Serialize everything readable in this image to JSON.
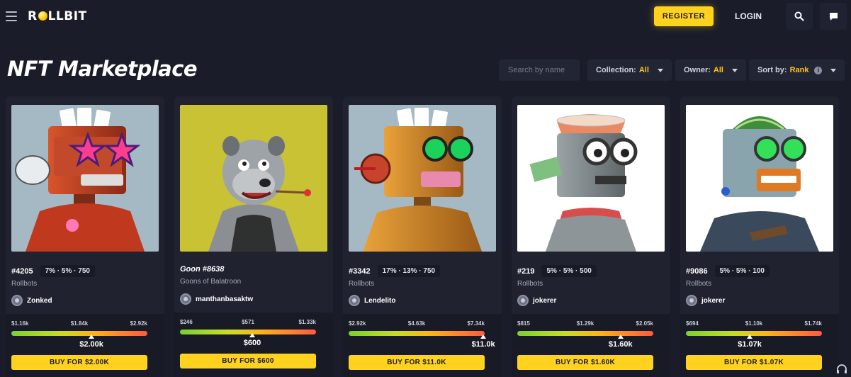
{
  "brand": {
    "logo_text_pre": "R",
    "logo_text_post": "LLBIT"
  },
  "nav": {
    "register_label": "REGISTER",
    "login_label": "LOGIN",
    "search_icon": "search-icon",
    "chat_icon": "chat-icon",
    "menu_icon": "hamburger-icon"
  },
  "page": {
    "title": "NFT Marketplace"
  },
  "filters": {
    "search_placeholder": "Search by name",
    "collection": {
      "label": "Collection:",
      "value": "All"
    },
    "owner": {
      "label": "Owner:",
      "value": "All"
    },
    "sort": {
      "label": "Sort by:",
      "value": "Rank",
      "info_icon": "i"
    }
  },
  "colors": {
    "accent": "#ffd21f",
    "background": "#1a1d29",
    "card": "#20232f"
  },
  "cards": [
    {
      "id": "#4205",
      "stats": "7% · 5% · 750",
      "collection": "Rollbots",
      "owner": "Zonked",
      "price_low": "$1.16k",
      "price_mid": "$1.84k",
      "price_high": "$2.92k",
      "current": "$2.00k",
      "buy": "BUY FOR $2.00K",
      "marker_pos": 0.59,
      "bg": "#a5b9c4"
    },
    {
      "id": "Goon #8638",
      "stats": "",
      "collection": "Goons of Balatroon",
      "owner": "manthanbasaktw",
      "price_low": "$246",
      "price_mid": "$571",
      "price_high": "$1.33k",
      "current": "$600",
      "buy": "BUY FOR $600",
      "marker_pos": 0.53,
      "bg": "#c9c234"
    },
    {
      "id": "#3342",
      "stats": "17% · 13% · 750",
      "collection": "Rollbots",
      "owner": "Lendelito",
      "price_low": "$2.92k",
      "price_mid": "$4.63k",
      "price_high": "$7.34k",
      "current": "$11.0k",
      "buy": "BUY FOR $11.0K",
      "marker_pos": 0.99,
      "bg": "#a5b9c4"
    },
    {
      "id": "#219",
      "stats": "5% · 5% · 500",
      "collection": "Rollbots",
      "owner": "jokerer",
      "price_low": "$815",
      "price_mid": "$1.29k",
      "price_high": "$2.05k",
      "current": "$1.60k",
      "buy": "BUY FOR $1.60K",
      "marker_pos": 0.76,
      "bg": "#ffffff"
    },
    {
      "id": "#9086",
      "stats": "5% · 5% · 100",
      "collection": "Rollbots",
      "owner": "jokerer",
      "price_low": "$694",
      "price_mid": "$1.10k",
      "price_high": "$1.74k",
      "current": "$1.07k",
      "buy": "BUY FOR $1.07K",
      "marker_pos": 0.47,
      "bg": "#ffffff"
    }
  ]
}
